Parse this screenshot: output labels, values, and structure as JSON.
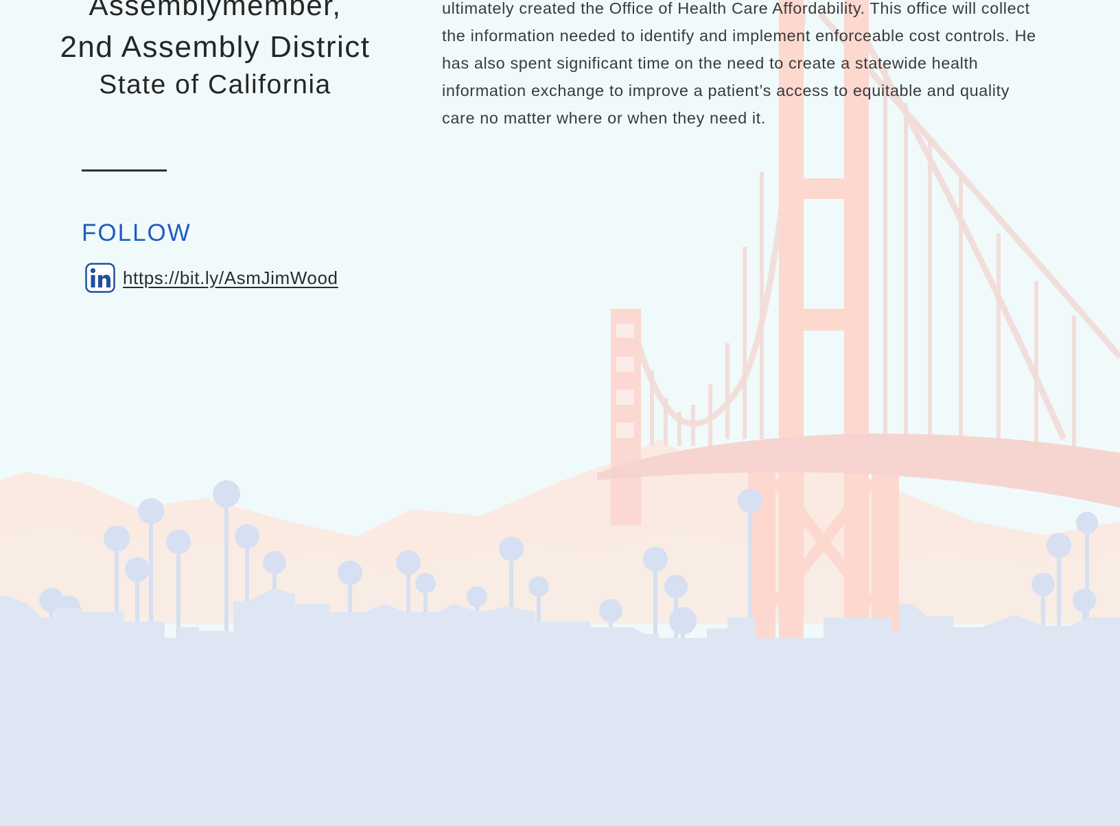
{
  "profile": {
    "title_lines": [
      "Assemblymember,",
      "2nd Assembly District",
      "State of California"
    ]
  },
  "follow": {
    "heading": "FOLLOW",
    "link_text": "https://bit.ly/AsmJimWood",
    "icon": "linkedin-icon"
  },
  "bio": {
    "text": "ultimately created the Office of Health Care Affordability. This office will collect the information needed to identify and implement enforceable cost controls. He has also spent significant time on the need to create a statewide health information exchange to improve a patient’s access to equitable and quality care no matter where or when they need it."
  },
  "theme": {
    "background": "#f1fafa",
    "accent": "#1f5bc0",
    "text": "#262626",
    "bridge": "#fbdcd6",
    "skyline": "#dfe6f3"
  }
}
